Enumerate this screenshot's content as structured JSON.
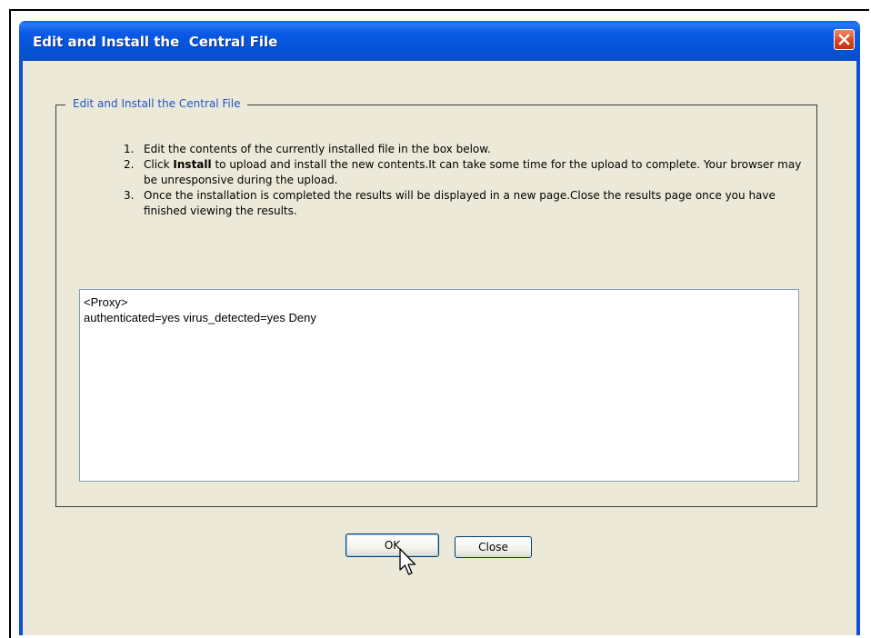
{
  "window": {
    "title": "Edit and Install the  Central File",
    "close_icon": "close-icon"
  },
  "group": {
    "legend": "Edit and Install the Central File"
  },
  "instructions": [
    {
      "num": "1.",
      "text": "Edit the contents of the currently installed file in the box below."
    },
    {
      "num": "2.",
      "text_before": "Click ",
      "bold": "Install",
      "text_after": " to upload and install the new contents.It can take some time for the upload to complete. Your browser may be unresponsive during the upload."
    },
    {
      "num": "3.",
      "text": "Once the installation is completed the results will be displayed in a new page.Close the results page once you have finished viewing the results."
    }
  ],
  "editor": {
    "line1": "<Proxy>",
    "line2": "authenticated=yes virus_detected=yes Deny"
  },
  "buttons": {
    "ok_label": "OK",
    "close_label": "Close"
  },
  "colors": {
    "titlebar": "#0a5ae6",
    "legend_text": "#2255c8",
    "dialog_bg": "#ece9d8"
  }
}
